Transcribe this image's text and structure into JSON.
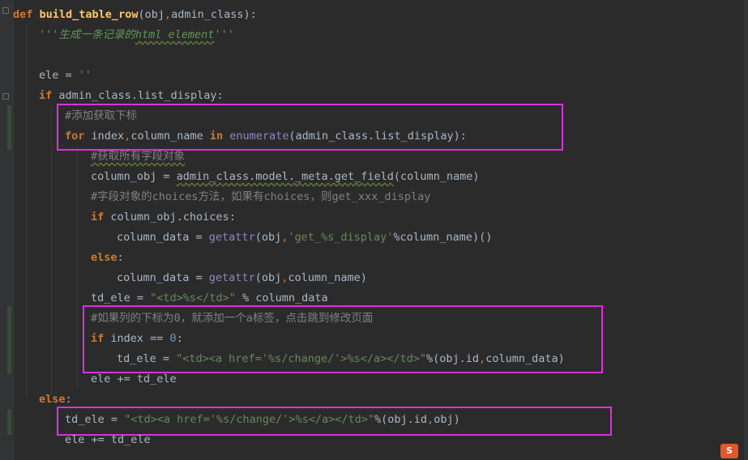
{
  "editor": {
    "lines": [
      {
        "id": "l1",
        "tokens": [
          {
            "t": "def",
            "c": "kw"
          },
          {
            "t": " ",
            "c": ""
          },
          {
            "t": "build_table_row",
            "c": "fn"
          },
          {
            "t": "(obj",
            "c": ""
          },
          {
            "t": ",",
            "c": "kwn"
          },
          {
            "t": "admin_class):",
            "c": ""
          }
        ]
      },
      {
        "id": "l2",
        "tokens": [
          {
            "t": "'''生成一条记录的",
            "c": "doc"
          },
          {
            "t": "html element",
            "c": "doc wavy"
          },
          {
            "t": "'''",
            "c": "doc"
          }
        ]
      },
      {
        "id": "l3",
        "tokens": []
      },
      {
        "id": "l4",
        "tokens": [
          {
            "t": "ele = ",
            "c": ""
          },
          {
            "t": "''",
            "c": "str"
          }
        ]
      },
      {
        "id": "l5",
        "tokens": [
          {
            "t": "if",
            "c": "kw"
          },
          {
            "t": " admin_class.list_display:",
            "c": ""
          }
        ]
      },
      {
        "id": "l6",
        "tokens": [
          {
            "t": "#添加获取下标",
            "c": "cmt"
          }
        ]
      },
      {
        "id": "l7",
        "tokens": [
          {
            "t": "for",
            "c": "kw"
          },
          {
            "t": " index",
            "c": ""
          },
          {
            "t": ",",
            "c": "kwn"
          },
          {
            "t": "column_name ",
            "c": ""
          },
          {
            "t": "in",
            "c": "kw"
          },
          {
            "t": " ",
            "c": ""
          },
          {
            "t": "enumerate",
            "c": "bi"
          },
          {
            "t": "(admin_class.list_display):",
            "c": ""
          }
        ]
      },
      {
        "id": "l8",
        "tokens": [
          {
            "t": "#获取所有字段对象",
            "c": "cmt wavy"
          }
        ]
      },
      {
        "id": "l9",
        "tokens": [
          {
            "t": "column_obj = ",
            "c": ""
          },
          {
            "t": "admin_class.model._meta.get_field",
            "c": "wavy"
          },
          {
            "t": "(column_name)",
            "c": ""
          }
        ]
      },
      {
        "id": "l10",
        "tokens": [
          {
            "t": "#字段对象的choices方法，如果有choices，则get_xxx_display",
            "c": "cmt"
          }
        ]
      },
      {
        "id": "l11",
        "tokens": [
          {
            "t": "if",
            "c": "kw"
          },
          {
            "t": " column_obj.choices:",
            "c": ""
          }
        ]
      },
      {
        "id": "l12",
        "tokens": [
          {
            "t": "column_data = ",
            "c": ""
          },
          {
            "t": "getattr",
            "c": "bi"
          },
          {
            "t": "(obj",
            "c": ""
          },
          {
            "t": ",",
            "c": "kwn"
          },
          {
            "t": "'get_%s_display'",
            "c": "str"
          },
          {
            "t": "%column_name)()",
            "c": ""
          }
        ]
      },
      {
        "id": "l13",
        "tokens": [
          {
            "t": "else",
            "c": "kw"
          },
          {
            "t": ":",
            "c": ""
          }
        ]
      },
      {
        "id": "l14",
        "tokens": [
          {
            "t": "column_data = ",
            "c": ""
          },
          {
            "t": "getattr",
            "c": "bi"
          },
          {
            "t": "(obj",
            "c": ""
          },
          {
            "t": ",",
            "c": "kwn"
          },
          {
            "t": "column_name)",
            "c": ""
          }
        ]
      },
      {
        "id": "l15",
        "tokens": [
          {
            "t": "td_ele = ",
            "c": ""
          },
          {
            "t": "\"<td>%s</td>\"",
            "c": "str"
          },
          {
            "t": " % column_data",
            "c": ""
          }
        ]
      },
      {
        "id": "l16",
        "tokens": [
          {
            "t": "#如果列的下标为0，就添加一个a标签，点击跳到修改页面",
            "c": "cmt"
          }
        ]
      },
      {
        "id": "l17",
        "tokens": [
          {
            "t": "if",
            "c": "kw"
          },
          {
            "t": " index == ",
            "c": ""
          },
          {
            "t": "0",
            "c": "num"
          },
          {
            "t": ":",
            "c": ""
          }
        ]
      },
      {
        "id": "l18",
        "tokens": [
          {
            "t": "td_ele = ",
            "c": ""
          },
          {
            "t": "\"<td><a href='%s/change/'>%s</a></td>\"",
            "c": "str"
          },
          {
            "t": "%(obj.id",
            "c": ""
          },
          {
            "t": ",",
            "c": "kwn"
          },
          {
            "t": "column_data)",
            "c": ""
          }
        ]
      },
      {
        "id": "l19",
        "tokens": [
          {
            "t": "ele += td_ele",
            "c": ""
          }
        ]
      },
      {
        "id": "l20",
        "tokens": [
          {
            "t": "else",
            "c": "kw"
          },
          {
            "t": ":",
            "c": ""
          }
        ]
      },
      {
        "id": "l21",
        "tokens": [
          {
            "t": "td_ele = ",
            "c": ""
          },
          {
            "t": "\"<td><a href='%s/change/'>%s</a></td>\"",
            "c": "str"
          },
          {
            "t": "%(obj.id",
            "c": ""
          },
          {
            "t": ",",
            "c": "kwn"
          },
          {
            "t": "obj)",
            "c": ""
          }
        ]
      },
      {
        "id": "l22",
        "tokens": [
          {
            "t": "ele += td_ele",
            "c": ""
          }
        ]
      }
    ]
  },
  "highlight_color": "#dd30dd",
  "watermark": {
    "label": "S"
  }
}
